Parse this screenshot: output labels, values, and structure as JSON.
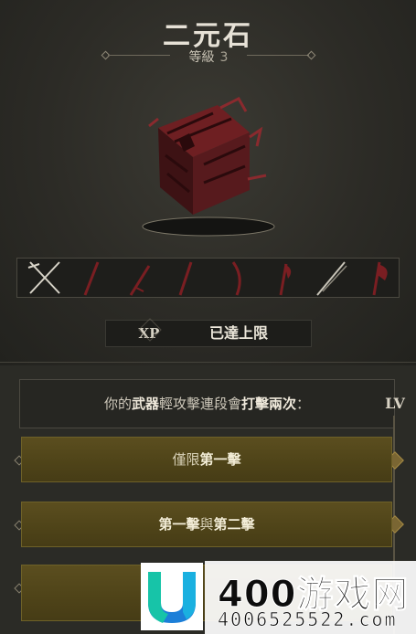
{
  "item": {
    "name": "二元石",
    "level_label": "等級",
    "level_value": "3"
  },
  "weapons": [
    {
      "icon": "twin-blades-icon"
    },
    {
      "icon": "spear-icon"
    },
    {
      "icon": "sword-icon"
    },
    {
      "icon": "staff-icon"
    },
    {
      "icon": "bow-icon"
    },
    {
      "icon": "axe-icon"
    },
    {
      "icon": "crossbow-icon"
    },
    {
      "icon": "greataxe-icon"
    }
  ],
  "xp": {
    "badge": "XP",
    "status": "已達上限"
  },
  "description": {
    "prefix": "你的",
    "w1": "武器",
    "mid1": "輕攻擊連段會",
    "w2": "打擊兩次",
    "suffix": "："
  },
  "level_track": {
    "badge": "LV"
  },
  "options": [
    {
      "prefix": "僅限",
      "emph": "第一擊",
      "suffix": ""
    },
    {
      "prefix": "",
      "emph": "第一擊",
      "mid": "與",
      "emph2": "第二擊"
    }
  ],
  "watermark": {
    "brand": "400游戏网",
    "phone": "4006525522.com"
  },
  "colors": {
    "accent_gold": "#5b4e1f",
    "background": "#2a2a25",
    "item_red": "#7a1e22"
  }
}
